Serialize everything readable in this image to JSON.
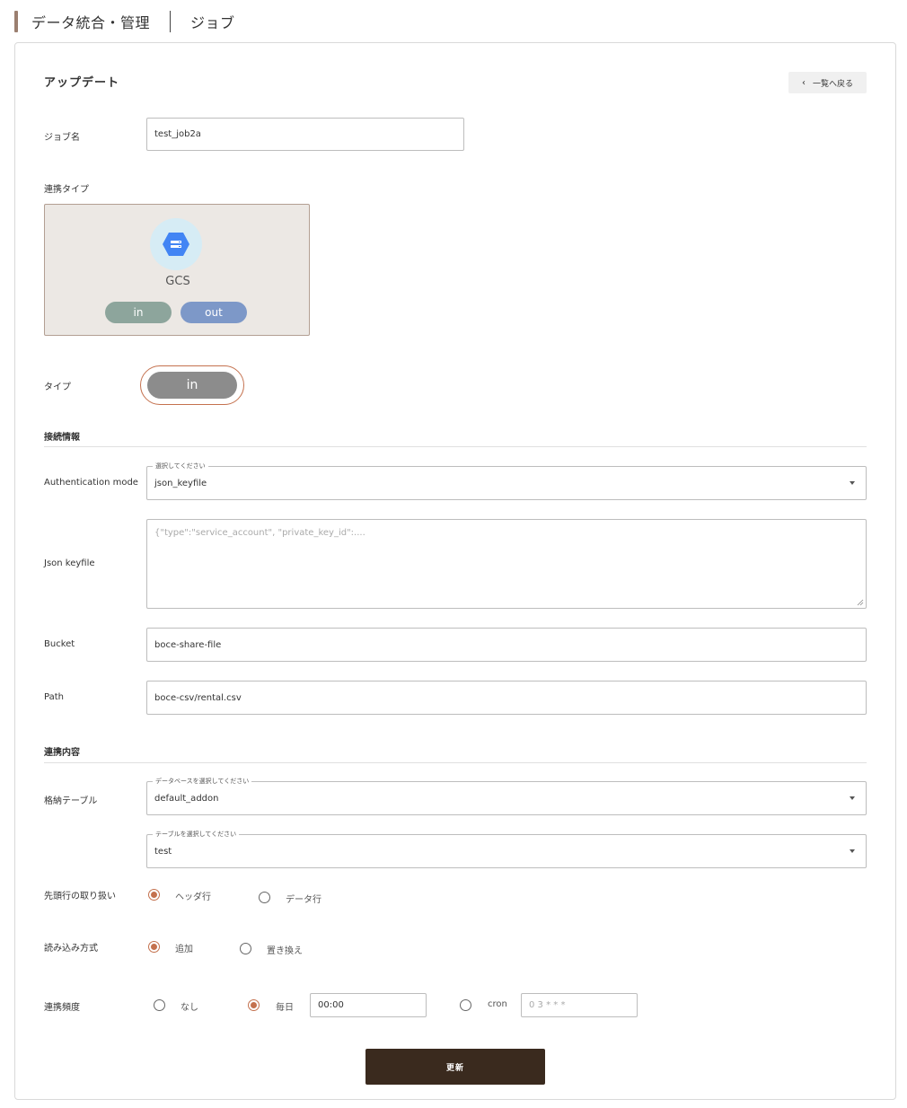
{
  "header": {
    "title": "データ統合・管理",
    "subtitle": "ジョブ"
  },
  "page": {
    "title": "アップデート",
    "back_label": "一覧へ戻る"
  },
  "job_name": {
    "label": "ジョブ名",
    "value": "test_job2a"
  },
  "integration_type": {
    "label": "連携タイプ",
    "service_name": "GCS",
    "in_label": "in",
    "out_label": "out"
  },
  "type": {
    "label": "タイプ",
    "value": "in"
  },
  "connection": {
    "section_title": "接続情報",
    "auth_mode": {
      "label": "Authentication mode",
      "legend": "選択してください",
      "value": "json_keyfile"
    },
    "json_keyfile": {
      "label": "Json keyfile",
      "placeholder": "{\"type\":\"service_account\", \"private_key_id\":...."
    },
    "bucket": {
      "label": "Bucket",
      "value": "boce-share-file"
    },
    "path": {
      "label": "Path",
      "value": "boce-csv/rental.csv"
    }
  },
  "content": {
    "section_title": "連携内容",
    "storage_table": {
      "label": "格納テーブル",
      "db_legend": "データベースを選択してください",
      "db_value": "default_addon",
      "table_legend": "テーブルを選択してください",
      "table_value": "test"
    },
    "first_row": {
      "label": "先頭行の取り扱い",
      "options": [
        "ヘッダ行",
        "データ行"
      ],
      "selected": "ヘッダ行"
    },
    "load_method": {
      "label": "読み込み方式",
      "options": [
        "追加",
        "置き換え"
      ],
      "selected": "追加"
    },
    "frequency": {
      "label": "連携頻度",
      "none_label": "なし",
      "daily_label": "毎日",
      "daily_time": "00:00",
      "cron_label": "cron",
      "cron_placeholder": "0 3 * * *",
      "selected": "毎日"
    }
  },
  "submit_label": "更新",
  "colors": {
    "accent": "#c4714e",
    "submit": "#3a2a1e",
    "in_pill": "#8da59c",
    "out_pill": "#7d98c8",
    "gcs_blue": "#4285f4"
  }
}
